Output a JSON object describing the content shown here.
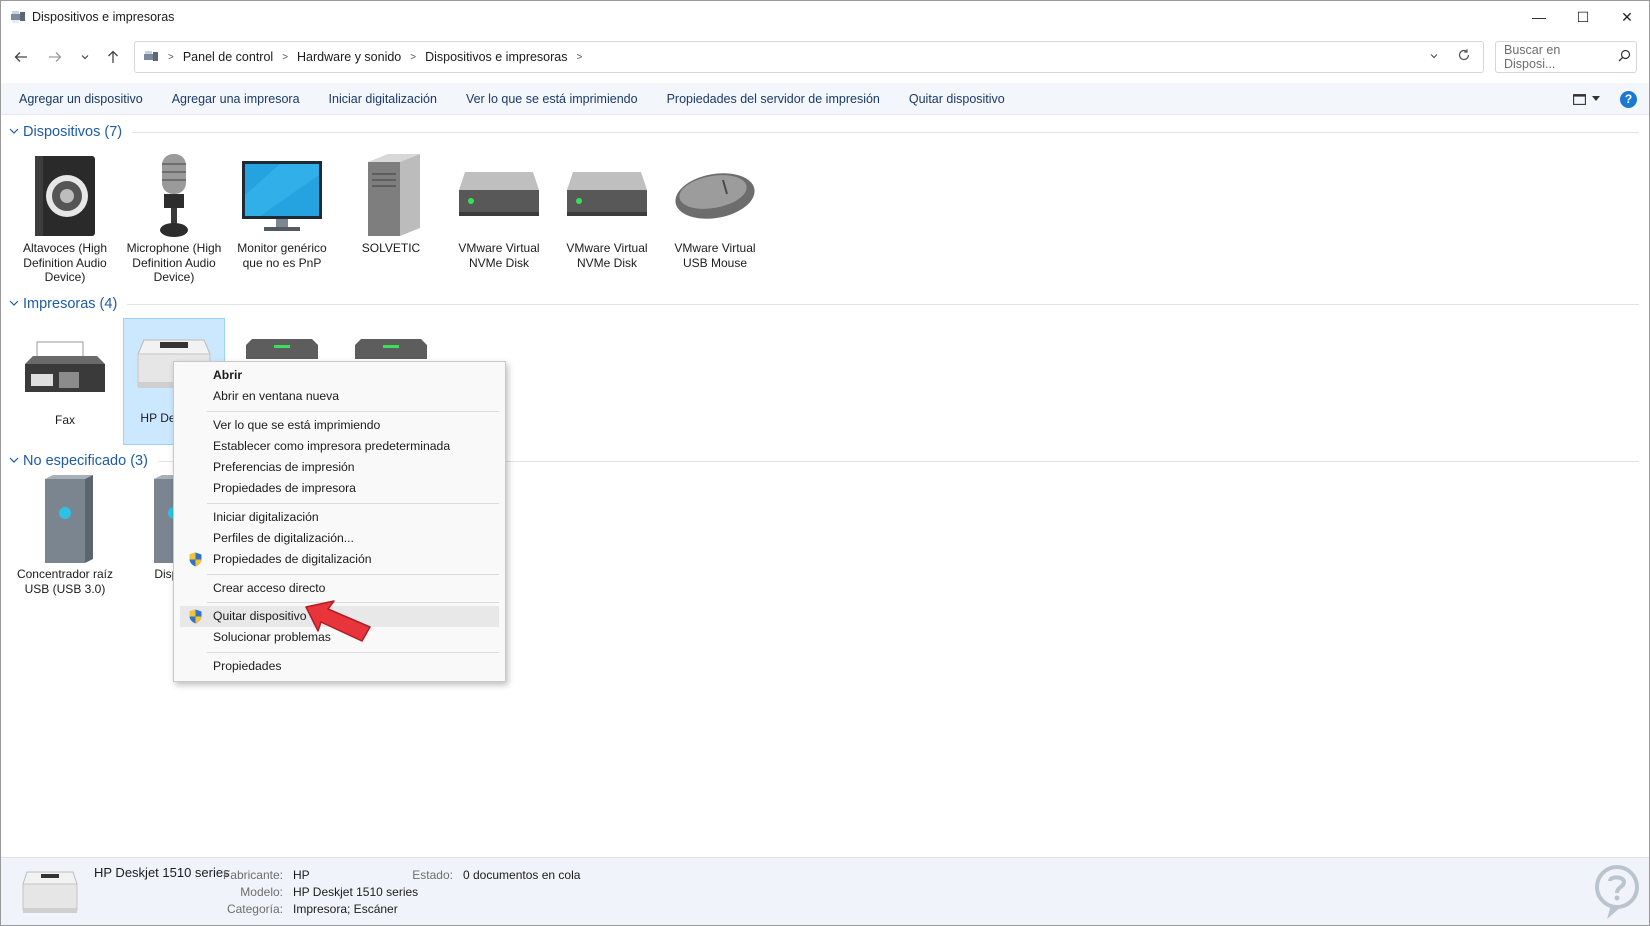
{
  "window": {
    "title": "Dispositivos e impresoras",
    "controls": {
      "minimize": "—",
      "maximize": "☐",
      "close": "✕"
    }
  },
  "nav": {
    "breadcrumb": [
      "Panel de control",
      "Hardware y sonido",
      "Dispositivos e impresoras"
    ],
    "search_placeholder": "Buscar en Disposi..."
  },
  "commands": [
    "Agregar un dispositivo",
    "Agregar una impresora",
    "Iniciar digitalización",
    "Ver lo que se está imprimiendo",
    "Propiedades del servidor de impresión",
    "Quitar dispositivo"
  ],
  "groups": {
    "devices": {
      "title": "Dispositivos (7)",
      "items": [
        {
          "label": "Altavoces (High Definition Audio Device)",
          "icon": "speaker-icon"
        },
        {
          "label": "Microphone (High Definition Audio Device)",
          "icon": "microphone-icon"
        },
        {
          "label": "Monitor genérico que no es PnP",
          "icon": "monitor-icon"
        },
        {
          "label": "SOLVETIC",
          "icon": "computer-tower-icon"
        },
        {
          "label": "VMware Virtual NVMe Disk",
          "icon": "drive-icon"
        },
        {
          "label": "VMware Virtual NVMe Disk",
          "icon": "drive-icon"
        },
        {
          "label": "VMware Virtual USB Mouse",
          "icon": "mouse-icon"
        }
      ]
    },
    "printers": {
      "title": "Impresoras (4)",
      "items": [
        {
          "label": "Fax",
          "icon": "fax-icon"
        },
        {
          "label": "HP Desk ser",
          "icon": "printer-icon"
        },
        {
          "label": "",
          "icon": "printer-icon"
        },
        {
          "label": "",
          "icon": "printer-icon"
        }
      ]
    },
    "unspecified": {
      "title": "No especificado (3)",
      "items": [
        {
          "label": "Concentrador raíz USB (USB 3.0)",
          "icon": "usb-hub-icon"
        },
        {
          "label": "Disposi",
          "icon": "usb-hub-icon"
        }
      ]
    }
  },
  "context_menu": {
    "items": [
      "Abrir",
      "Abrir en ventana nueva",
      "Ver lo que se está imprimiendo",
      "Establecer como impresora predeterminada",
      "Preferencias de impresión",
      "Propiedades de impresora",
      "Iniciar digitalización",
      "Perfiles de digitalización...",
      "Propiedades de digitalización",
      "Crear acceso directo",
      "Quitar dispositivo",
      "Solucionar problemas",
      "Propiedades"
    ]
  },
  "details": {
    "name": "HP Deskjet 1510 series",
    "fabricante_key": "Fabricante:",
    "fabricante": "HP",
    "modelo_key": "Modelo:",
    "modelo": "HP Deskjet 1510 series",
    "categoria_key": "Categoría:",
    "categoria": "Impresora; Escáner",
    "estado_key": "Estado:",
    "estado": "0 documentos en cola"
  },
  "colors": {
    "accent": "#1e5aa8",
    "command_text": "#1b3a67",
    "selection": "#cce8ff",
    "arrow": "#e8353b"
  }
}
